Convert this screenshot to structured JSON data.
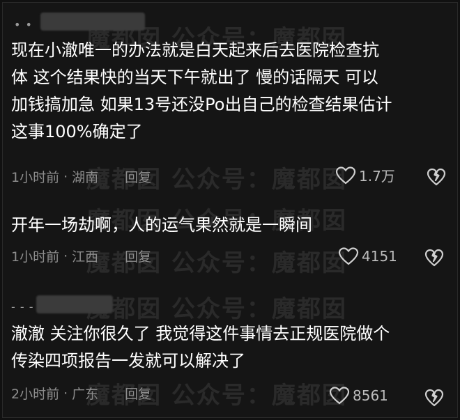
{
  "watermark": "魔都囡 公众号：魔都囡",
  "comments": [
    {
      "text_lines": [
        "现在小澈唯一的办法就是白天起来后去医院检查抗",
        "体 这个结果快的当天下午就出了 慢的话隔天 可以",
        "加钱搞加急 如果13号还没Po出自己的检查结果估计",
        "这事100%确定了"
      ],
      "time": "1小时前",
      "location": "湖南",
      "reply_label": "回复",
      "likes": "1.7万"
    },
    {
      "text_lines": [
        "开年一场劫啊，人的运气果然就是一瞬间"
      ],
      "time": "1小时前",
      "location": "江西",
      "reply_label": "回复",
      "likes": "4151"
    },
    {
      "text_lines": [
        "澈澈 关注你很久了 我觉得这件事情去正规医院做个",
        "传染四项报告一发就可以解决了"
      ],
      "time": "2小时前",
      "location": "广东",
      "reply_label": "回复",
      "likes": "8561"
    }
  ],
  "icons": {
    "like": "heart-outline-icon",
    "dislike": "broken-heart-icon"
  },
  "colors": {
    "background": "#151515",
    "text": "#ffffff",
    "meta": "#8d8d8d"
  }
}
